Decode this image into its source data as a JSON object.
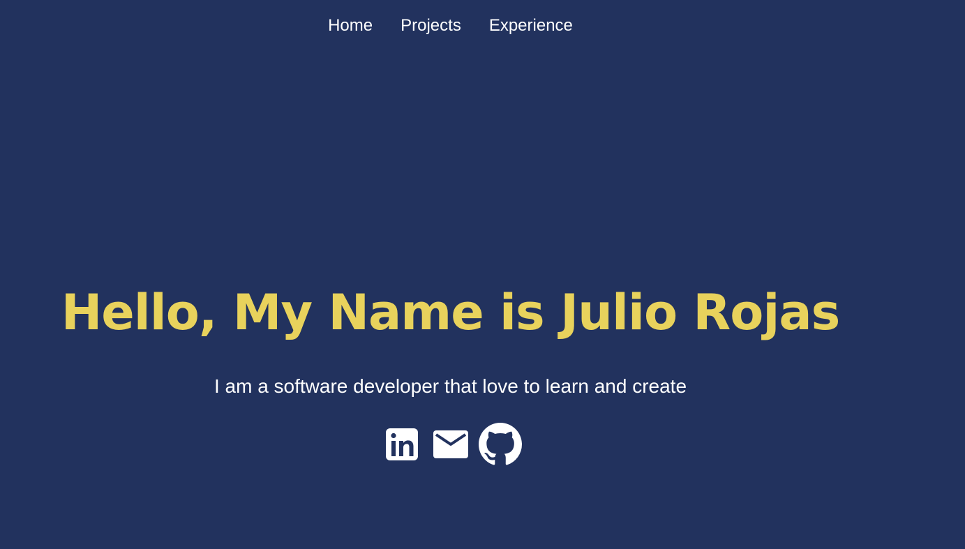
{
  "nav": {
    "items": [
      {
        "label": "Home"
      },
      {
        "label": "Projects"
      },
      {
        "label": "Experience"
      }
    ]
  },
  "hero": {
    "title": "Hello, My Name is Julio Rojas",
    "subtitle": "I am a software developer that love to learn and create"
  },
  "social": {
    "icons": [
      "linkedin-icon",
      "email-icon",
      "github-icon"
    ]
  },
  "colors": {
    "background": "#22325e",
    "accent": "#e8d25c",
    "text": "#ffffff"
  }
}
